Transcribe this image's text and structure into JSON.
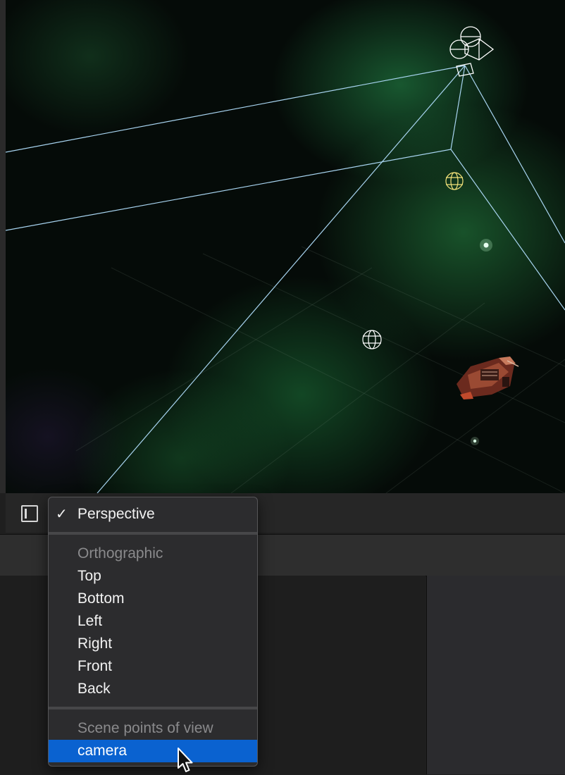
{
  "menu": {
    "perspective": {
      "label": "Perspective",
      "checked": true
    },
    "orthographic_header": "Orthographic",
    "orthographic_items": [
      "Top",
      "Bottom",
      "Left",
      "Right",
      "Front",
      "Back"
    ],
    "scene_header": "Scene points of view",
    "scene_items": [
      {
        "label": "camera",
        "highlighted": true
      }
    ]
  },
  "colors": {
    "selection": "#0a62d0",
    "wireframe": "#a8d4f0",
    "light_gizmo": "#f2e27a"
  },
  "icons": {
    "panel_toggle": "sidebar-left-icon",
    "checkmark": "checkmark-icon",
    "cursor": "arrow-cursor-icon"
  }
}
